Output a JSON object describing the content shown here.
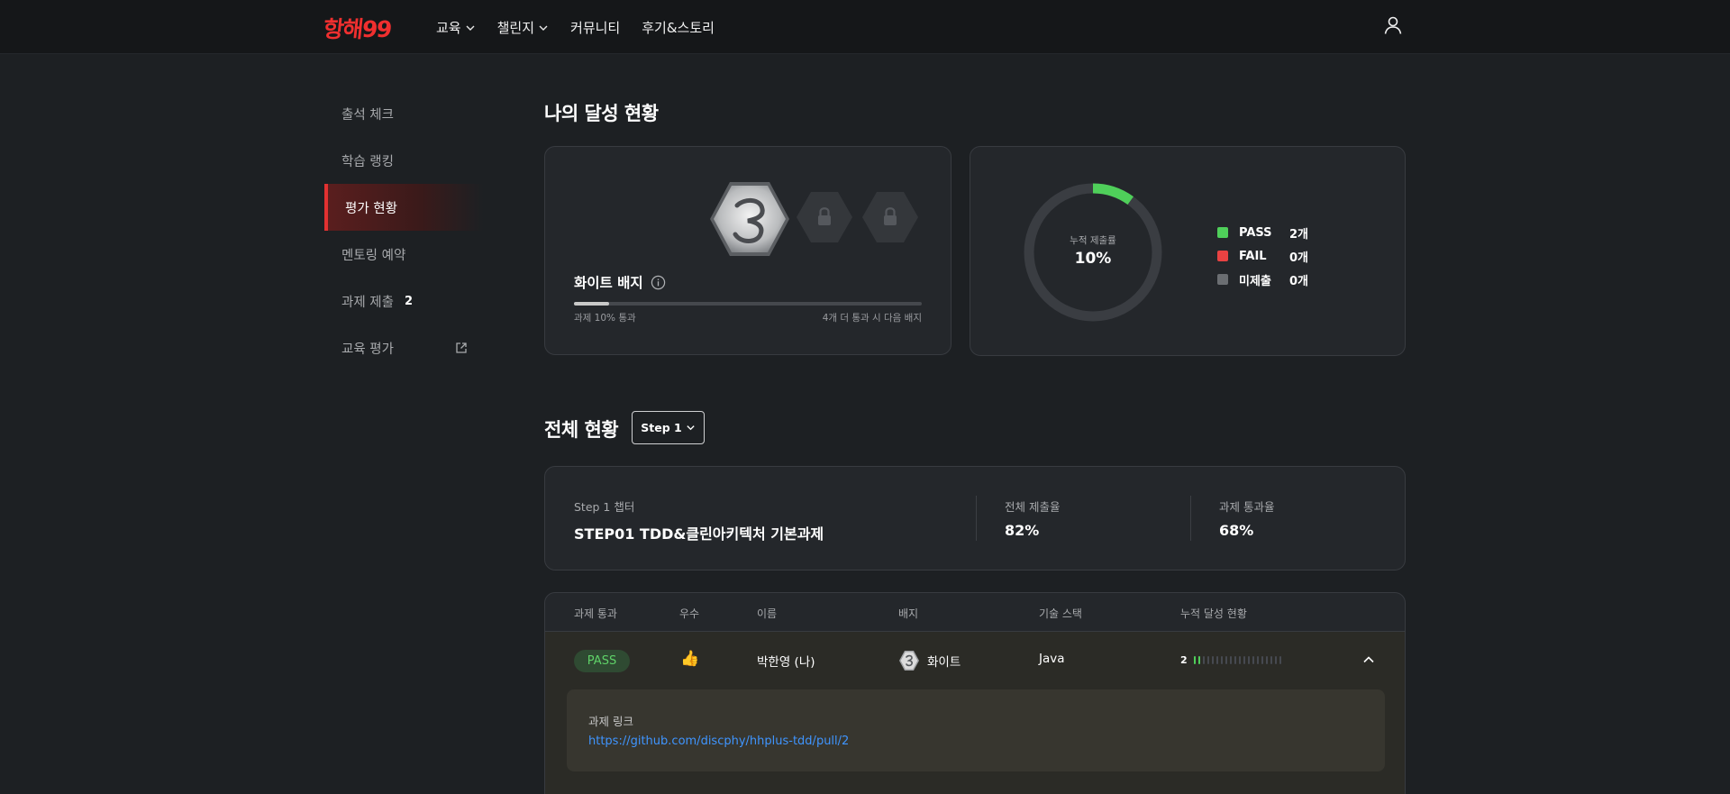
{
  "header": {
    "logo_text": "항해99",
    "nav": [
      {
        "label": "교육",
        "has_dropdown": true
      },
      {
        "label": "챌린지",
        "has_dropdown": true
      },
      {
        "label": "커뮤니티",
        "has_dropdown": false
      },
      {
        "label": "후기&스토리",
        "has_dropdown": false
      }
    ],
    "user_icon": "user-icon"
  },
  "sidebar": {
    "items": [
      {
        "label": "출석 체크"
      },
      {
        "label": "학습 랭킹"
      },
      {
        "label": "평가 현황",
        "active": true
      },
      {
        "label": "멘토링 예약"
      },
      {
        "label": "과제 제출",
        "count": "2"
      },
      {
        "label": "교육 평가",
        "icon": "external-link-icon"
      }
    ]
  },
  "achievement": {
    "title": "나의 달성 현황",
    "badge_name": "화이트 배지",
    "progress_fraction": 0.1,
    "progress_left": "과제 10% 통과",
    "progress_right": "4개 더 통과 시 다음 배지",
    "locked_icon": "lock-icon",
    "donut_label": "누적 제출률",
    "donut_value": "10%",
    "donut_fraction": 0.1,
    "legend": [
      {
        "name": "PASS",
        "count": "2개",
        "color": "#4fcf5a"
      },
      {
        "name": "FAIL",
        "count": "0개",
        "color": "#e84242"
      },
      {
        "name": "미제출",
        "count": "0개",
        "color": "#6b6e72"
      }
    ]
  },
  "overview": {
    "title": "전체 현황",
    "step_selector": "Step 1",
    "chapter_label": "Step 1 챕터",
    "chapter_name": "STEP01 TDD&클린아키텍처 기본과제",
    "submit_rate_label": "전체 제출율",
    "submit_rate": "82%",
    "pass_rate_label": "과제 통과율",
    "pass_rate": "68%"
  },
  "table": {
    "headers": [
      "과제 통과",
      "우수",
      "이름",
      "배지",
      "기술 스택",
      "누적 달성 현황"
    ],
    "row": {
      "result": "PASS",
      "excellent": "👍",
      "name": "박한영 (나)",
      "badge": "화이트",
      "stack": "Java",
      "streak_count": "2",
      "streak_total": 20,
      "streak_done": 2
    },
    "link_label": "과제 링크",
    "link_url": "https://github.com/discphy/hhplus-tdd/pull/2"
  },
  "colors": {
    "accent": "#e23131",
    "pass": "#4fcf5a",
    "link": "#3f95ff"
  }
}
